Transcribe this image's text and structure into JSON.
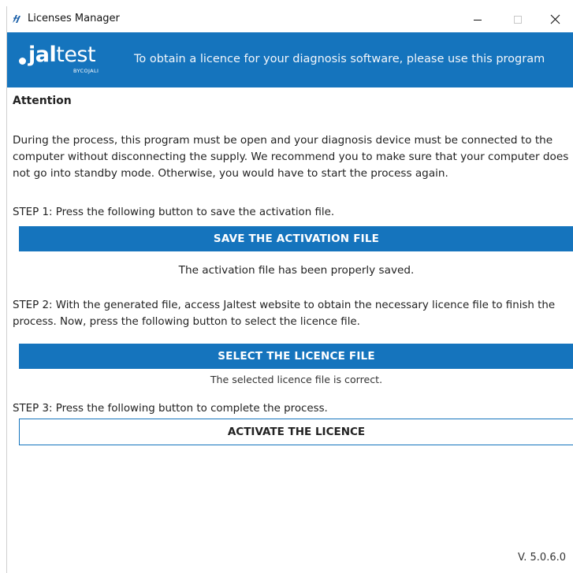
{
  "window": {
    "title": "Licenses Manager",
    "controls": {
      "minimize": "–",
      "maximize": "☐",
      "close": "✕"
    }
  },
  "banner": {
    "logo_text_bold": "jal",
    "logo_text_light": "test",
    "logo_sub": "BYCOJALI",
    "tagline": "To obtain a licence for your diagnosis software, please use this program",
    "color": "#1574bd"
  },
  "main": {
    "heading": "Attention",
    "paragraph": "During the process, this program must be open and your diagnosis device must be connected to the computer without disconnecting the supply. We recommend you to make sure that your computer does not go into standby mode. Otherwise, you would have to start the process again.",
    "step1": {
      "text": "STEP 1: Press the following button to save the activation file.",
      "button": "SAVE THE ACTIVATION FILE",
      "status": "The activation file has been properly saved."
    },
    "step2": {
      "text": "STEP 2: With the generated file, access Jaltest website to obtain the necessary licence file to finish the process. Now, press the following button to select the licence file.",
      "button": "SELECT THE LICENCE FILE",
      "status": "The selected licence file is correct."
    },
    "step3": {
      "text": "STEP 3: Press the following button to complete the process.",
      "button": "ACTIVATE THE LICENCE"
    }
  },
  "footer": {
    "version": "V. 5.0.6.0"
  }
}
